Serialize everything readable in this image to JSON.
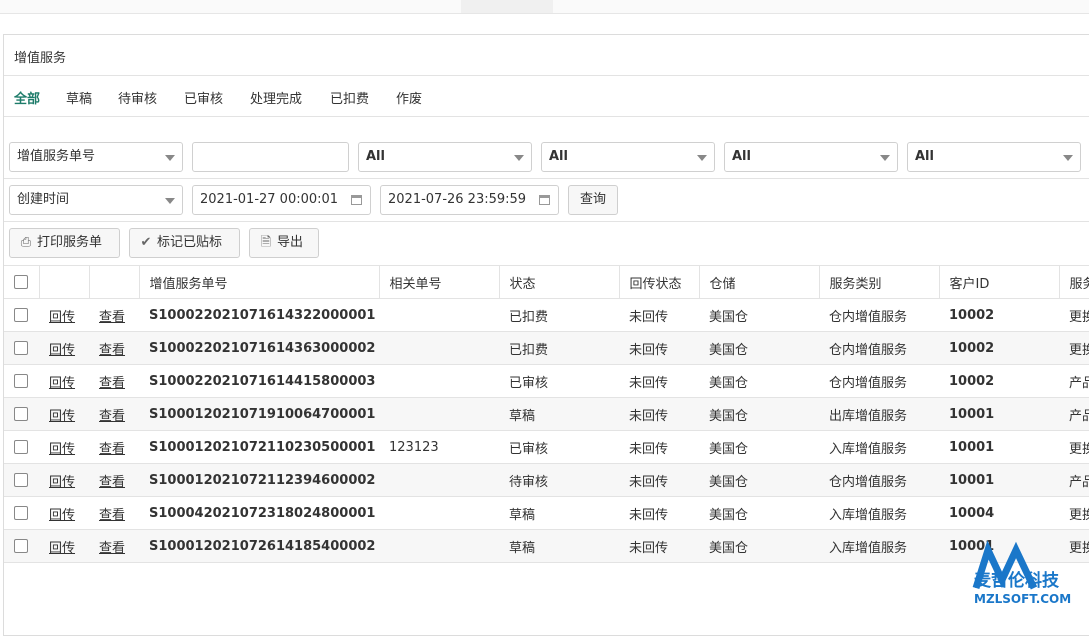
{
  "panel": {
    "title": "增值服务"
  },
  "tabs": [
    "全部",
    "草稿",
    "待审核",
    "已审核",
    "处理完成",
    "已扣费",
    "作废"
  ],
  "filters": {
    "row1": {
      "search_field": "增值服务单号",
      "search_value": "",
      "select1": "All",
      "select2": "All",
      "select3": "All",
      "select4": "All"
    },
    "row2": {
      "time_field": "创建时间",
      "start_time": "2021-01-27 00:00:01",
      "end_time": "2021-07-26 23:59:59",
      "query_button": "查询"
    }
  },
  "toolbar": {
    "print_label": "打印服务单",
    "mark_label": "标记已贴标",
    "export_label": "导出"
  },
  "table": {
    "headers": [
      "增值服务单号",
      "相关单号",
      "状态",
      "回传状态",
      "仓储",
      "服务类别",
      "客户ID",
      "服务"
    ],
    "action_reply": "回传",
    "action_view": "查看",
    "rows": [
      {
        "sn": "S100022021071614322000001",
        "ref": "",
        "status": "已扣费",
        "reply": "未回传",
        "wh": "美国仓",
        "cat": "仓内增值服务",
        "cid": "10002",
        "svc": "更换"
      },
      {
        "sn": "S100022021071614363000002",
        "ref": "",
        "status": "已扣费",
        "reply": "未回传",
        "wh": "美国仓",
        "cat": "仓内增值服务",
        "cid": "10002",
        "svc": "更换"
      },
      {
        "sn": "S100022021071614415800003",
        "ref": "",
        "status": "已审核",
        "reply": "未回传",
        "wh": "美国仓",
        "cat": "仓内增值服务",
        "cid": "10002",
        "svc": "产品"
      },
      {
        "sn": "S100012021071910064700001",
        "ref": "",
        "status": "草稿",
        "reply": "未回传",
        "wh": "美国仓",
        "cat": "出库增值服务",
        "cid": "10001",
        "svc": "产品"
      },
      {
        "sn": "S100012021072110230500001",
        "ref": "123123",
        "status": "已审核",
        "reply": "未回传",
        "wh": "美国仓",
        "cat": "入库增值服务",
        "cid": "10001",
        "svc": "更换"
      },
      {
        "sn": "S100012021072112394600002",
        "ref": "",
        "status": "待审核",
        "reply": "未回传",
        "wh": "美国仓",
        "cat": "仓内增值服务",
        "cid": "10001",
        "svc": "产品"
      },
      {
        "sn": "S100042021072318024800001",
        "ref": "",
        "status": "草稿",
        "reply": "未回传",
        "wh": "美国仓",
        "cat": "入库增值服务",
        "cid": "10004",
        "svc": "更换"
      },
      {
        "sn": "S100012021072614185400002",
        "ref": "",
        "status": "草稿",
        "reply": "未回传",
        "wh": "美国仓",
        "cat": "入库增值服务",
        "cid": "10001",
        "svc": "更换"
      }
    ]
  },
  "watermark": {
    "name": "麦哲伦科技",
    "url": "MZLSOFT.COM",
    "color": "#1a77c9"
  },
  "colors": {
    "active_tab": "#1e7c6a"
  }
}
